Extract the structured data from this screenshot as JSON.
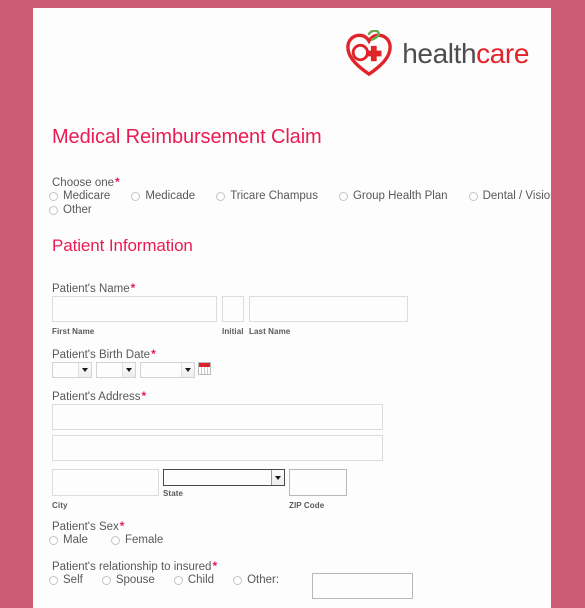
{
  "background_color": "#cc5b74",
  "brand": {
    "logo_icon": "heart-with-cross-icon",
    "name_part_1": "health",
    "name_part_2": "care",
    "color_dark": "#4d4d4f",
    "color_accent": "#e1242a"
  },
  "form": {
    "title": "Medical Reimbursement Claim",
    "accent_color": "#ea1b54",
    "required_marker": "*"
  },
  "choose_one": {
    "label": "Choose one",
    "required": true,
    "options": [
      "Medicare",
      "Medicade",
      "Tricare Champus",
      "Group Health Plan",
      "Dental / Vision",
      "Other"
    ],
    "selected": null
  },
  "patient_information": {
    "section_title": "Patient Information",
    "name": {
      "label": "Patient's Name",
      "required": true,
      "first_name": {
        "value": "",
        "sub_label": "First Name"
      },
      "initial": {
        "value": "",
        "sub_label": "Initial"
      },
      "last_name": {
        "value": "",
        "sub_label": "Last Name"
      }
    },
    "birth_date": {
      "label": "Patient's Birth Date",
      "required": true,
      "month": "",
      "day": "",
      "year": "",
      "calendar_icon": "calendar-picker-icon"
    },
    "address": {
      "label": "Patient's Address",
      "required": true,
      "line1": "",
      "line2": "",
      "city": {
        "value": "",
        "sub_label": "City"
      },
      "state": {
        "value": "",
        "sub_label": "State"
      },
      "zip": {
        "value": "",
        "sub_label": "ZIP Code"
      }
    },
    "sex": {
      "label": "Patient's Sex",
      "required": true,
      "options": [
        "Male",
        "Female"
      ],
      "selected": null
    },
    "relationship": {
      "label": "Patient's relationship to insured",
      "required": true,
      "options": [
        "Self",
        "Spouse",
        "Child",
        "Other:"
      ],
      "selected": null,
      "other_value": ""
    }
  }
}
